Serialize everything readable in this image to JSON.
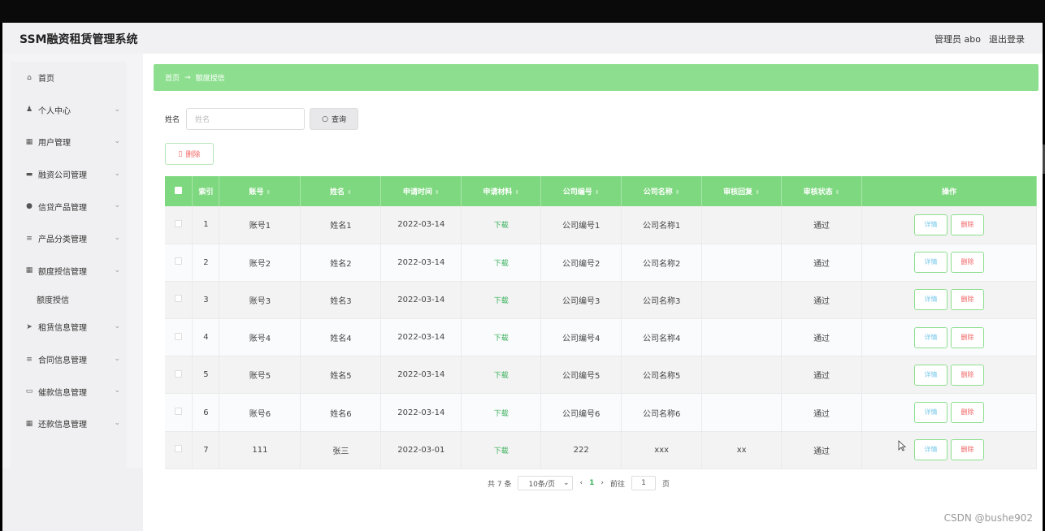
{
  "header": {
    "app_title": "SSM融资租赁管理系统",
    "user_label": "管理员 abo",
    "logout_label": "退出登录"
  },
  "sidebar": {
    "items": [
      {
        "label": "首页",
        "icon": "home-icon",
        "glyph": "⌂",
        "chevron": false
      },
      {
        "label": "个人中心",
        "icon": "user-icon",
        "glyph": "♟",
        "chevron": true
      },
      {
        "label": "用户管理",
        "icon": "grid-icon",
        "glyph": "▦",
        "chevron": true
      },
      {
        "label": "融资公司管理",
        "icon": "card-icon",
        "glyph": "▬",
        "chevron": true
      },
      {
        "label": "信贷产品管理",
        "icon": "pin-icon",
        "glyph": "●",
        "chevron": true
      },
      {
        "label": "产品分类管理",
        "icon": "list-icon",
        "glyph": "≡",
        "chevron": true
      },
      {
        "label": "额度授信管理",
        "icon": "grid-icon",
        "glyph": "▦",
        "chevron": true
      },
      {
        "label": "额度授信",
        "sub": true
      },
      {
        "label": "租赁信息管理",
        "icon": "send-icon",
        "glyph": "➤",
        "chevron": true
      },
      {
        "label": "合同信息管理",
        "icon": "doc-icon",
        "glyph": "≡",
        "chevron": true
      },
      {
        "label": "催款信息管理",
        "icon": "tray-icon",
        "glyph": "▭",
        "chevron": true
      },
      {
        "label": "还款信息管理",
        "icon": "grid-icon",
        "glyph": "▦",
        "chevron": true
      }
    ]
  },
  "breadcrumb": {
    "home": "首页",
    "separator": "→",
    "current": "额度授信"
  },
  "search": {
    "label": "姓名",
    "placeholder": "姓名",
    "button_label": "查询"
  },
  "toolbar": {
    "delete_label": "删除"
  },
  "table": {
    "headers": [
      "索引",
      "账号",
      "姓名",
      "申请时间",
      "申请材料",
      "公司编号",
      "公司名称",
      "审核回复",
      "审核状态",
      "操作"
    ],
    "detail_label": "详情",
    "delete_label": "删除",
    "rows": [
      {
        "index": "1",
        "account": "账号1",
        "name": "姓名1",
        "date": "2022-03-14",
        "material": "下载",
        "company_no": "公司编号1",
        "company_name": "公司名称1",
        "reply": "",
        "status": "通过"
      },
      {
        "index": "2",
        "account": "账号2",
        "name": "姓名2",
        "date": "2022-03-14",
        "material": "下载",
        "company_no": "公司编号2",
        "company_name": "公司名称2",
        "reply": "",
        "status": "通过"
      },
      {
        "index": "3",
        "account": "账号3",
        "name": "姓名3",
        "date": "2022-03-14",
        "material": "下载",
        "company_no": "公司编号3",
        "company_name": "公司名称3",
        "reply": "",
        "status": "通过"
      },
      {
        "index": "4",
        "account": "账号4",
        "name": "姓名4",
        "date": "2022-03-14",
        "material": "下载",
        "company_no": "公司编号4",
        "company_name": "公司名称4",
        "reply": "",
        "status": "通过"
      },
      {
        "index": "5",
        "account": "账号5",
        "name": "姓名5",
        "date": "2022-03-14",
        "material": "下载",
        "company_no": "公司编号5",
        "company_name": "公司名称5",
        "reply": "",
        "status": "通过"
      },
      {
        "index": "6",
        "account": "账号6",
        "name": "姓名6",
        "date": "2022-03-14",
        "material": "下载",
        "company_no": "公司编号6",
        "company_name": "公司名称6",
        "reply": "",
        "status": "通过"
      },
      {
        "index": "7",
        "account": "111",
        "name": "张三",
        "date": "2022-03-01",
        "material": "下载",
        "company_no": "222",
        "company_name": "xxx",
        "reply": "xx",
        "status": "通过"
      }
    ]
  },
  "pagination": {
    "total": "共 7 条",
    "page_size": "10条/页",
    "current_page": "1",
    "goto_label": "前往",
    "goto_value": "1",
    "page_suffix": "页"
  },
  "watermark": "CSDN @bushe902",
  "colors": {
    "accent": "#7ed87f",
    "danger": "#f06464",
    "link": "#3ab15b"
  }
}
